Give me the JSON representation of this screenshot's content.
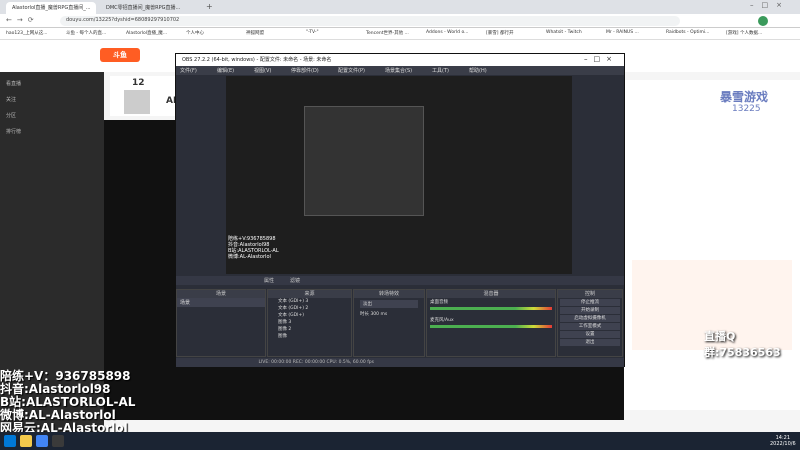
{
  "browser": {
    "tabs": [
      {
        "label": "Alastorlol直播_魔兽RPG直播间_..."
      },
      {
        "label": "DMC零招直播间_魔兽RPG直播..."
      }
    ],
    "url": "douyu.com/13225?dyshid=68089297910702",
    "bookmarks": [
      "hao123_上网从这...",
      "斗鱼 - 每个人的直...",
      "Alastorlol直播_魔...",
      "个人中心",
      "神狐网盟",
      "\"-TV-\"",
      "Tencent世界-其他 ...",
      "Addons - World o...",
      "[暴雪] 都行开",
      "Whatsit - Twitch",
      "Mr - RAINUS ...",
      "Raidbots - Optimi...",
      "[游戏] 个人数据..."
    ]
  },
  "room": {
    "number_badge": "12",
    "host_short": "AL",
    "logo_title": "暴雪游戏",
    "room_id": "13225"
  },
  "sidebar": {
    "items": [
      "看直播",
      "关注",
      "分区",
      "排行榜"
    ]
  },
  "obs": {
    "title": "OBS 27.2.2 (64-bit, windows) - 配置文件: 未命名 - 场景: 未命名",
    "menu": [
      "文件(F)",
      "编辑(E)",
      "视图(V)",
      "停靠部件(D)",
      "配置文件(P)",
      "场景集合(S)",
      "工具(T)",
      "帮助(H)"
    ],
    "preview_overlay": [
      "陪练+V:936785898",
      "抖音:Alastorlol98",
      "B站:ALASTORLOL-AL",
      "微博:AL-Alastorlol"
    ],
    "tabs": [
      "属性",
      "滤镜"
    ],
    "docks": {
      "scenes": "场景",
      "sources": "来源",
      "transitions": "转场特效",
      "mixer": "混音器",
      "controls": "控制"
    },
    "scene_item": "场景",
    "sources": [
      "文本 (GDI+) 3",
      "文本 (GDI+) 2",
      "文本 (GDI+)",
      "图像 3",
      "图像 2",
      "图像"
    ],
    "transition": {
      "type": "淡出",
      "duration_label": "时长",
      "duration": "300 ms"
    },
    "mixer_channels": [
      "桌面音频",
      "麦克风/Aux"
    ],
    "mixer_db": [
      "0.0 dB",
      "0.0 dB"
    ],
    "controls": [
      "停止推流",
      "开始录制",
      "启动虚拟摄像机",
      "工作室模式",
      "设置",
      "退出"
    ],
    "status": "LIVE: 00:00:00  REC: 00:00:00  CPU: 0.5%, 60.00 fps"
  },
  "overlay": {
    "lines": [
      "陪练+V：936785898",
      "抖音:Alastorlol98",
      "B站:ALASTORLOL-AL",
      "微博:AL-Alastorlol",
      "网易云:AL-Alastorlol"
    ],
    "qq_group": "直播Q群:75836563"
  },
  "taskbar": {
    "time": "14:21",
    "date": "2022/10/6"
  }
}
